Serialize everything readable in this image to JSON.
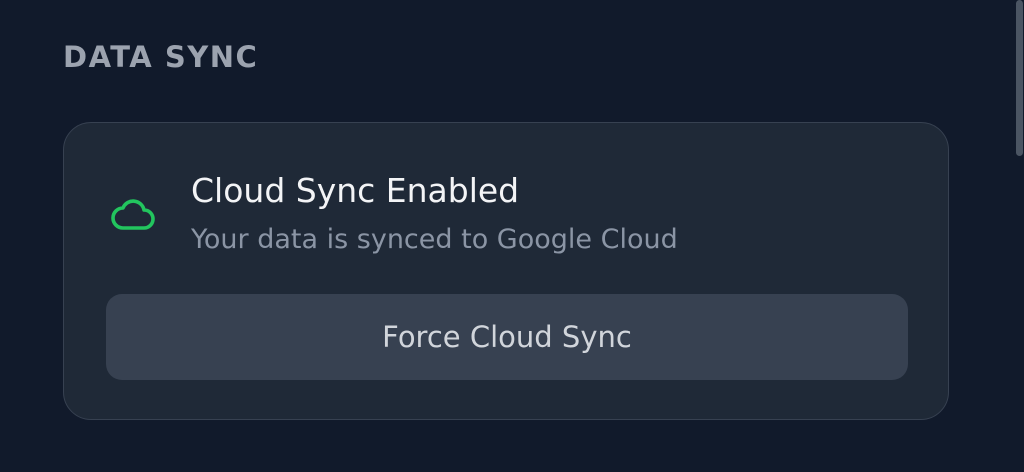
{
  "section": {
    "title": "DATA SYNC"
  },
  "sync_card": {
    "icon": "cloud-icon",
    "status_title": "Cloud Sync Enabled",
    "status_description": "Your data is synced to Google Cloud",
    "button_label": "Force Cloud Sync"
  },
  "colors": {
    "background": "#111a2b",
    "card": "#1f2937",
    "button": "#374151",
    "accent_green": "#22c55e"
  }
}
